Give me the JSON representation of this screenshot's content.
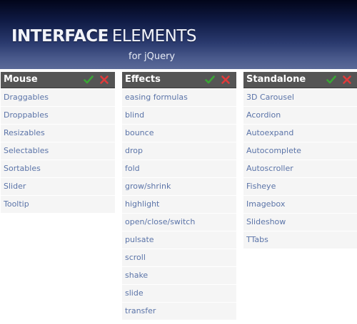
{
  "header": {
    "title_bold": "INTERFACE",
    "title_rest": "ELEMENTS",
    "subtitle": "for jQuery"
  },
  "colors": {
    "panel_header": "#555555",
    "item_bg": "#f5f5f5",
    "link": "#5b74a8",
    "check": "#39a635",
    "cross": "#e03a3a"
  },
  "icons": {
    "check": "check-icon",
    "cross": "close-icon"
  },
  "panels": [
    {
      "title": "Mouse",
      "items": [
        "Draggables",
        "Droppables",
        "Resizables",
        "Selectables",
        "Sortables",
        "Slider",
        "Tooltip"
      ]
    },
    {
      "title": "Effects",
      "items": [
        "easing formulas",
        "blind",
        "bounce",
        "drop",
        "fold",
        "grow/shrink",
        "highlight",
        "open/close/switch",
        "pulsate",
        "scroll",
        "shake",
        "slide",
        "transfer"
      ]
    },
    {
      "title": "Standalone",
      "items": [
        "3D Carousel",
        "Acordion",
        "Autoexpand",
        "Autocomplete",
        "Autoscroller",
        "Fisheye",
        "Imagebox",
        "Slideshow",
        "TTabs"
      ]
    }
  ]
}
